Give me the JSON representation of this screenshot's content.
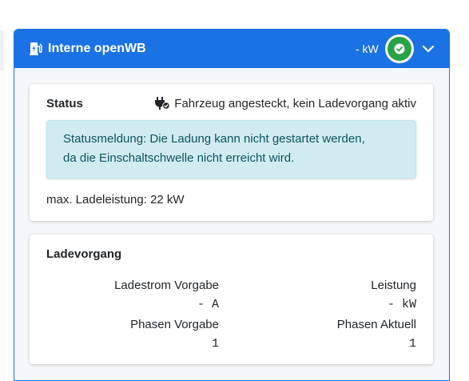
{
  "panel": {
    "title": "Interne openWB",
    "power": "- kW",
    "status_color": "#27a244",
    "accent": "#1b72e4"
  },
  "status_card": {
    "heading": "Status",
    "plug_state": "Fahrzeug angesteckt, kein Ladevorgang aktiv",
    "alert_line1": "Statusmeldung: Die Ladung kann nicht gestartet werden,",
    "alert_line2": "da die Einschaltschwelle nicht erreicht wird.",
    "max_power": "max. Ladeleistung: 22 kW"
  },
  "charge_card": {
    "heading": "Ladevorgang",
    "items": [
      {
        "label": "Ladestrom Vorgabe",
        "value": "- A"
      },
      {
        "label": "Leistung",
        "value": "- kW"
      },
      {
        "label": "Phasen Vorgabe",
        "value": "1"
      },
      {
        "label": "Phasen Aktuell",
        "value": "1"
      }
    ]
  }
}
